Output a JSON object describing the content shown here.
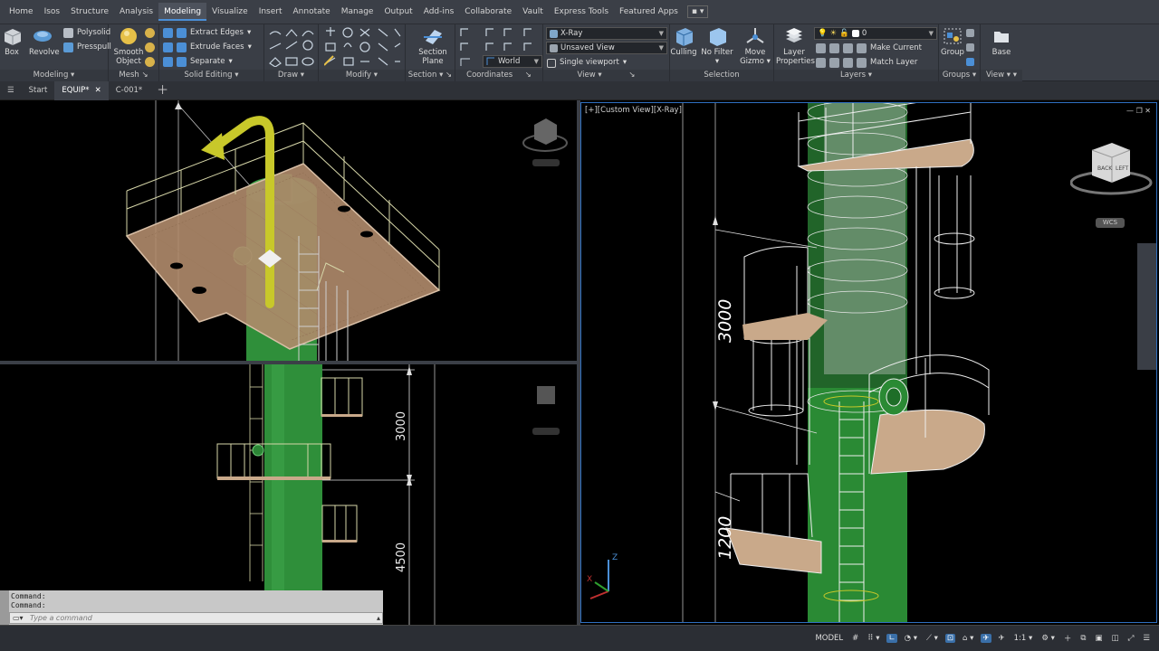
{
  "menu": [
    "Home",
    "Isos",
    "Structure",
    "Analysis",
    "Modeling",
    "Visualize",
    "Insert",
    "Annotate",
    "Manage",
    "Output",
    "Add-ins",
    "Collaborate",
    "Vault",
    "Express Tools",
    "Featured Apps"
  ],
  "menu_active": "Modeling",
  "ribbon": {
    "modeling": {
      "title": "Modeling",
      "box": "Box",
      "revolve": "Revolve",
      "polysolid": "Polysolid",
      "presspull": "Presspull"
    },
    "mesh": {
      "title": "Mesh",
      "smooth1": "Smooth",
      "smooth2": "Object"
    },
    "solid_editing": {
      "title": "Solid Editing",
      "extract": "Extract Edges",
      "extrude": "Extrude Faces",
      "separate": "Separate"
    },
    "draw": {
      "title": "Draw"
    },
    "modify": {
      "title": "Modify"
    },
    "section": {
      "title": "Section",
      "plane1": "Section",
      "plane2": "Plane"
    },
    "coordinates": {
      "title": "Coordinates",
      "world": "World"
    },
    "view": {
      "title": "View",
      "visual_style": "X-Ray",
      "named_view": "Unsaved View",
      "viewport": "Single viewport"
    },
    "selection": {
      "title": "Selection",
      "culling": "Culling",
      "filter": "No Filter",
      "gizmo1": "Move",
      "gizmo2": "Gizmo"
    },
    "layers": {
      "title": "Layers",
      "props1": "Layer",
      "props2": "Properties",
      "current_layer": "0",
      "make_current": "Make Current",
      "match_layer": "Match Layer"
    },
    "groups": {
      "title": "Groups",
      "group": "Group"
    },
    "viewpanel": {
      "title": "View",
      "base": "Base"
    }
  },
  "tabs": [
    {
      "label": "Start"
    },
    {
      "label": "EQUIP*",
      "active": true
    },
    {
      "label": "C-001*"
    }
  ],
  "viewports": {
    "right_label": "[+][Custom View][X-Ray]",
    "viewcube_back": "BACK",
    "viewcube_left": "LEFT",
    "wcs": "WCS"
  },
  "dimensions": {
    "left_top": "3000",
    "left_bottom": "4500",
    "right_top": "3000",
    "right_bottom": "1200"
  },
  "ucs": {
    "z": "Z",
    "x": "X"
  },
  "command": {
    "history": [
      "Command:",
      "Command:"
    ],
    "placeholder": "Type a command"
  },
  "status": {
    "model": "MODEL",
    "scale": "1:1"
  },
  "colors": {
    "vessel": "#2f8f3a",
    "platform": "#c9a98a",
    "railing": "#d6d6a8",
    "pipe": "#c8c82a",
    "ribbon_bg": "#3a3e46",
    "accent": "#4b8fd6"
  }
}
